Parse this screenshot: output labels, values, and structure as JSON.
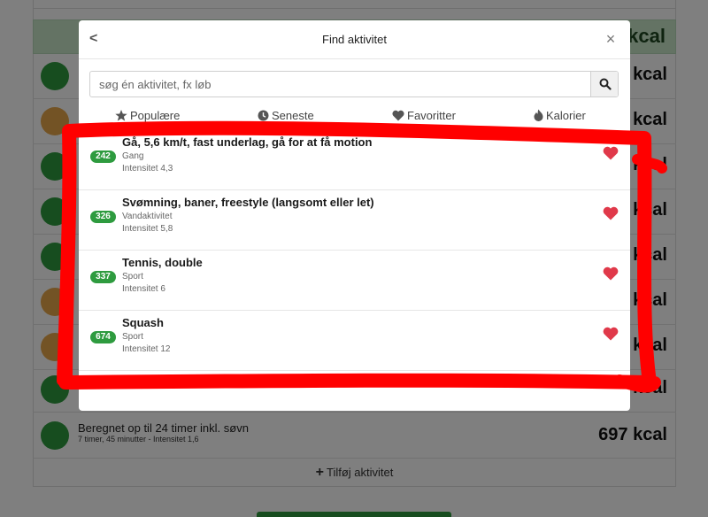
{
  "background": {
    "header_kcal": "kcal",
    "rows": [
      {
        "color": "green",
        "kcal": "kcal"
      },
      {
        "color": "orange",
        "kcal": "kcal"
      },
      {
        "color": "green",
        "kcal": "kcal"
      },
      {
        "color": "green",
        "kcal": "kcal"
      },
      {
        "color": "green",
        "kcal": "kcal"
      },
      {
        "color": "orange",
        "kcal": "kcal"
      },
      {
        "color": "orange",
        "kcal": "kcal"
      },
      {
        "color": "green",
        "kcal": "kcal"
      }
    ],
    "last_row": {
      "title": "Beregnet op til 24 timer inkl. søvn",
      "subtitle": "7 timer, 45 minutter - Intensitet 1,6",
      "kcal": "697 kcal"
    },
    "add_button": "Tilføj aktivitet"
  },
  "modal": {
    "back": "<",
    "title": "Find aktivitet",
    "close": "×",
    "search": {
      "placeholder": "søg én aktivitet, fx løb",
      "value": ""
    },
    "tabs": [
      {
        "label": "Populære",
        "icon": "star-icon"
      },
      {
        "label": "Seneste",
        "icon": "clock-icon"
      },
      {
        "label": "Favoritter",
        "icon": "heart-icon"
      },
      {
        "label": "Kalorier",
        "icon": "flame-icon"
      }
    ],
    "items": [
      {
        "badge": "242",
        "title": "Gå, 5,6 km/t, fast underlag, gå for at få motion",
        "category": "Gang",
        "intensity": "Intensitet 4,3"
      },
      {
        "badge": "326",
        "title": "Svømning, baner, freestyle (langsomt eller let)",
        "category": "Vandaktivitet",
        "intensity": "Intensitet 5,8"
      },
      {
        "badge": "337",
        "title": "Tennis, double",
        "category": "Sport",
        "intensity": "Intensitet 6"
      },
      {
        "badge": "674",
        "title": "Squash",
        "category": "Sport",
        "intensity": "Intensitet 12"
      }
    ]
  },
  "colors": {
    "accent_green": "#2e9b3f",
    "heart_red": "#e0394a",
    "annotation_red": "#ff0000",
    "orange": "#e6a64a"
  }
}
